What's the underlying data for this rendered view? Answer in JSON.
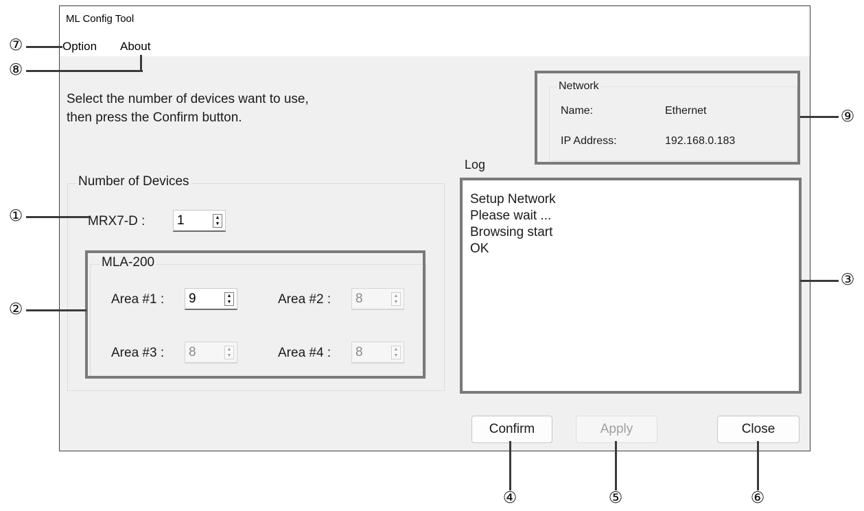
{
  "window": {
    "title": "ML Config Tool"
  },
  "menu": {
    "option": "Option",
    "about": "About"
  },
  "instructions": {
    "line1": "Select the number of devices want to use,",
    "line2": "then press the Confirm button."
  },
  "devices": {
    "group_label": "Number of Devices",
    "mrx_label": "MRX7-D :",
    "mrx_value": "1",
    "mla": {
      "group_label": "MLA-200",
      "areas": [
        {
          "label": "Area #1 :",
          "value": "9",
          "enabled": true
        },
        {
          "label": "Area #2 :",
          "value": "8",
          "enabled": false
        },
        {
          "label": "Area #3 :",
          "value": "8",
          "enabled": false
        },
        {
          "label": "Area #4 :",
          "value": "8",
          "enabled": false
        }
      ]
    }
  },
  "network": {
    "group_label": "Network",
    "name_label": "Name:",
    "name_value": "Ethernet",
    "ip_label": "IP Address:",
    "ip_value": "192.168.0.183"
  },
  "log": {
    "label": "Log",
    "lines": [
      "Setup Network",
      "Please wait ...",
      "Browsing start",
      "OK"
    ]
  },
  "buttons": {
    "confirm": {
      "label": "Confirm",
      "enabled": true
    },
    "apply": {
      "label": "Apply",
      "enabled": false
    },
    "close": {
      "label": "Close",
      "enabled": true
    }
  },
  "callouts": [
    "①",
    "②",
    "③",
    "④",
    "⑤",
    "⑥",
    "⑦",
    "⑧",
    "⑨"
  ],
  "spin_icons": {
    "up": "▲",
    "down": "▼"
  },
  "colors": {
    "window_bg": "#f0f0f0",
    "highlight_border": "#7a7a7a",
    "disabled_text": "#8a8a8a"
  }
}
